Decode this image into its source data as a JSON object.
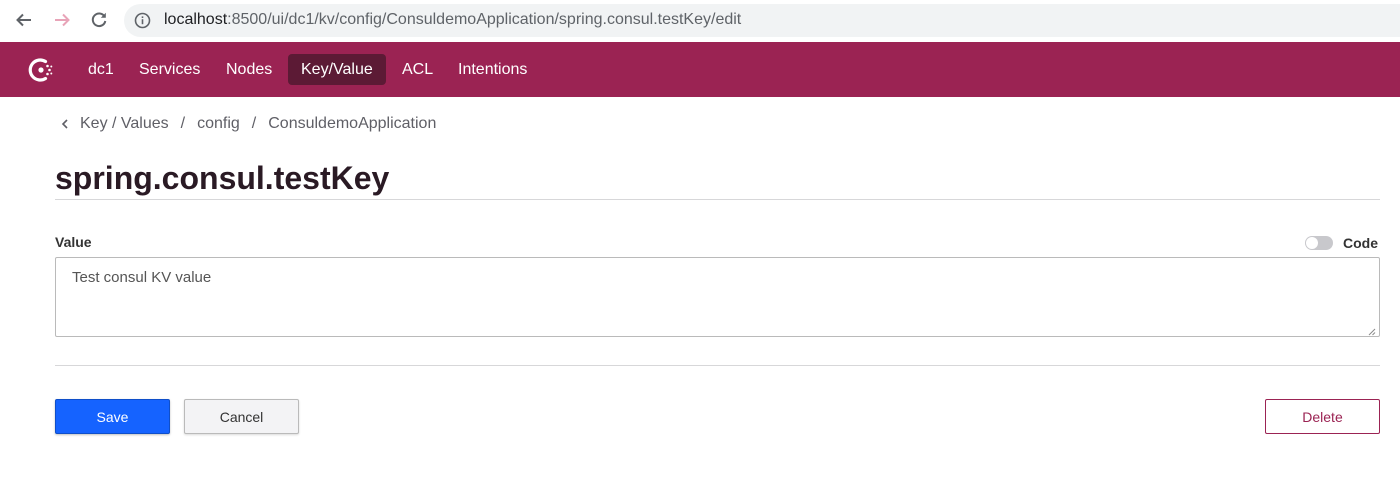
{
  "browser": {
    "url_host": "localhost",
    "url_path": ":8500/ui/dc1/kv/config/ConsuldemoApplication/spring.consul.testKey/edit"
  },
  "header": {
    "datacenter": "dc1",
    "nav": {
      "services": "Services",
      "nodes": "Nodes",
      "key_value": "Key/Value",
      "acl": "ACL",
      "intentions": "Intentions"
    },
    "active_item": "Key/Value",
    "brand_color": "#9b2353"
  },
  "breadcrumb": {
    "items": [
      "Key / Values",
      "config",
      "ConsuldemoApplication"
    ],
    "separator": "/"
  },
  "page": {
    "title": "spring.consul.testKey"
  },
  "form": {
    "value_label": "Value",
    "value": "Test consul KV value",
    "code_toggle_label": "Code",
    "code_toggle_on": false
  },
  "actions": {
    "save_label": "Save",
    "cancel_label": "Cancel",
    "delete_label": "Delete"
  },
  "colors": {
    "primary_button": "#1563ff",
    "danger": "#9b2353"
  },
  "icons": [
    "back-arrow-icon",
    "forward-arrow-icon",
    "reload-icon",
    "info-icon",
    "consul-logo-icon",
    "chevron-left-icon"
  ]
}
